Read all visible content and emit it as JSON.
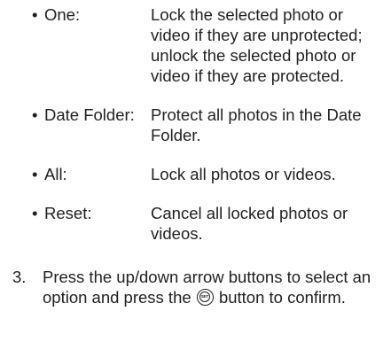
{
  "options": [
    {
      "bullet": "•",
      "term": "One:",
      "description": "Lock the selected photo or video if they are unprotected; unlock the selected photo or video if they are protected."
    },
    {
      "bullet": "•",
      "term": "Date Folder:",
      "description": "Protect all photos in the Date Folder."
    },
    {
      "bullet": "•",
      "term": "All:",
      "description": "Lock all photos or videos."
    },
    {
      "bullet": "•",
      "term": "Reset:",
      "description": "Cancel all locked photos or videos."
    }
  ],
  "step": {
    "number": "3.",
    "text_before_icon": "Press the up/down arrow buttons to select an option and press the",
    "icon": "set-button-icon",
    "icon_label": "SET",
    "text_after_icon": "button to confirm."
  }
}
